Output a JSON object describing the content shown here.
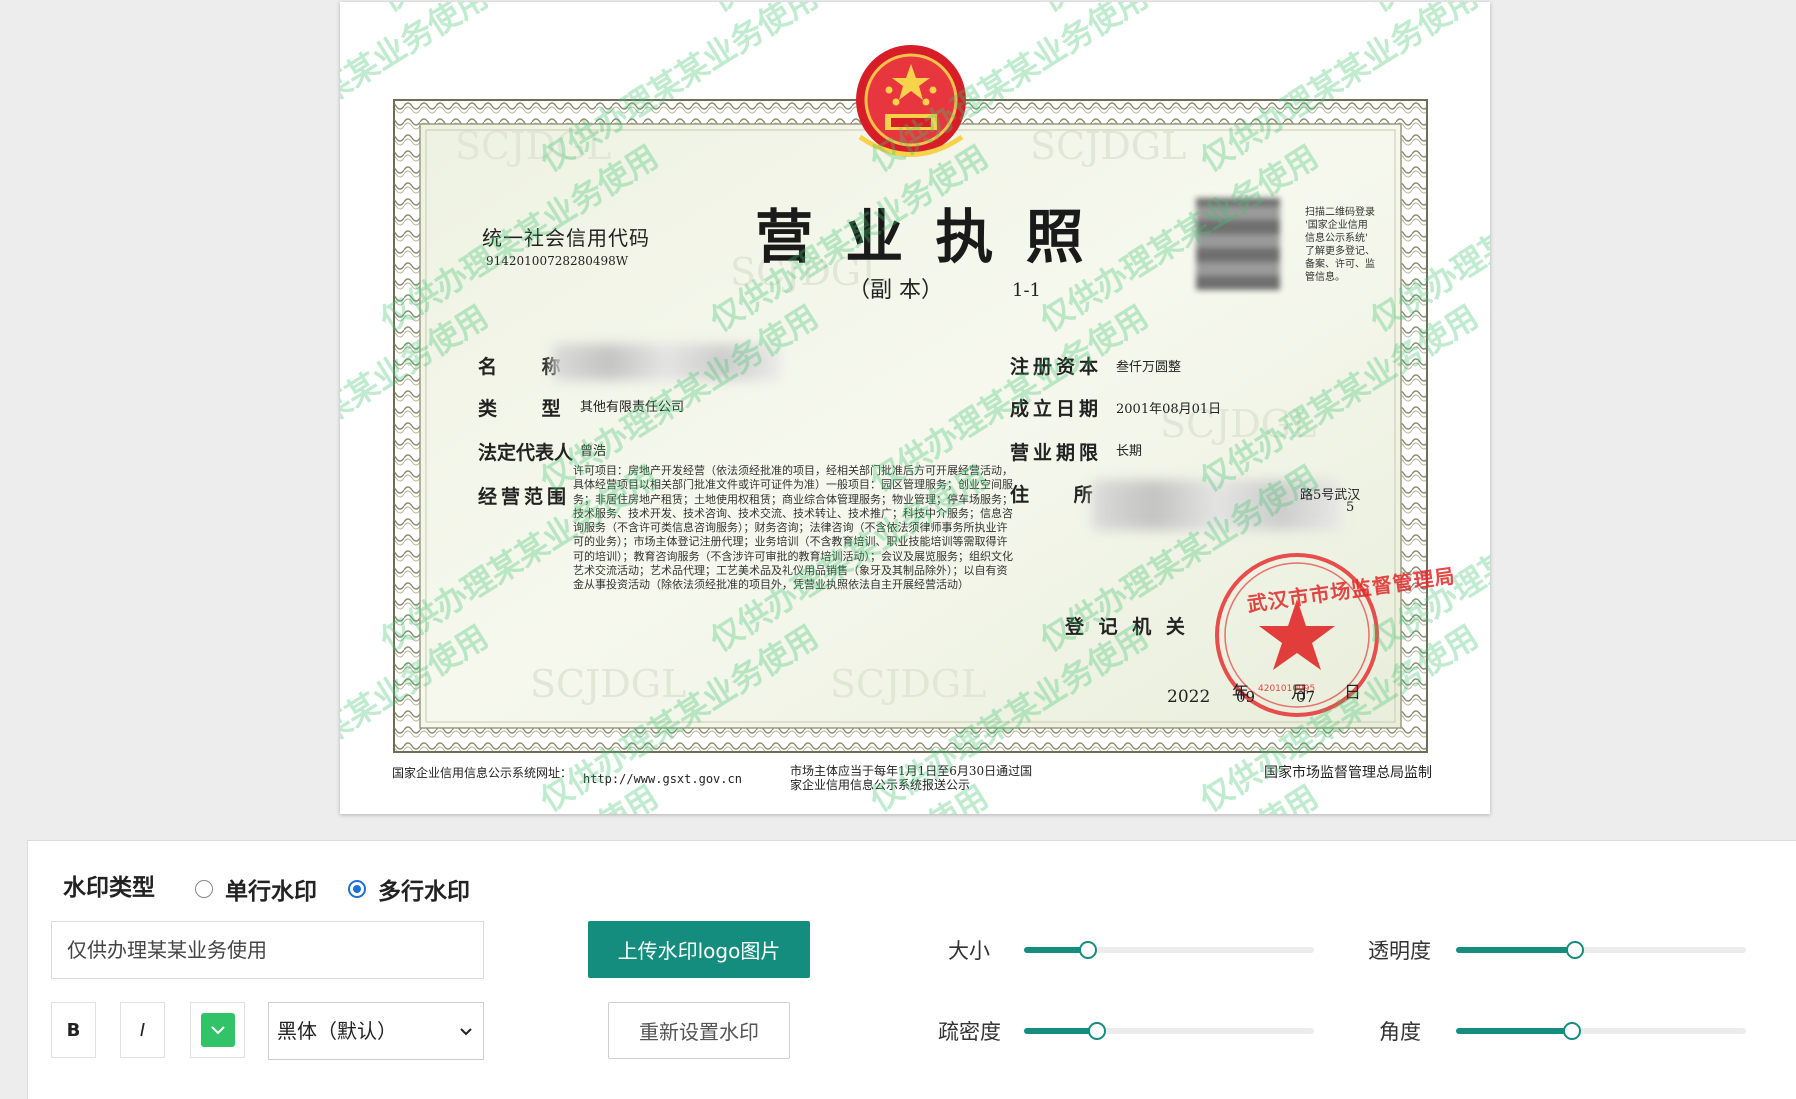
{
  "certificate": {
    "title": "营 业 执 照",
    "subtitle": "（副 本）",
    "copy_no": "1-1",
    "credit_code_label": "统一社会信用代码",
    "credit_code": "91420100728280498W",
    "qr_note": [
      "扫描二维码登录",
      "'国家企业信用",
      "信息公示系统'",
      "了解更多登记、",
      "备案、许可、监",
      "管信息。"
    ],
    "fields": {
      "name_label": "名 称",
      "type_label": "类 型",
      "type_value": "其他有限责任公司",
      "legal_rep_label": "法定代表人",
      "legal_rep_value": "曾浩",
      "scope_label": "经营范围",
      "capital_label": "注册资本",
      "capital_value": "叁仟万圆整",
      "founded_label": "成立日期",
      "founded_value": "2001年08月01日",
      "term_label": "营业期限",
      "term_value": "长期",
      "address_label": "住 所",
      "address_partial": "路5号武汉",
      "address_partial_2": "5"
    },
    "scope_text": "许可项目：房地产开发经营（依法须经批准的项目，经相关部门批准后方可开展经营活动，具体经营项目以相关部门批准文件或许可证件为准）一般项目：园区管理服务；创业空间服务；非居住房地产租赁；土地使用权租赁；商业综合体管理服务；物业管理；停车场服务；技术服务、技术开发、技术咨询、技术交流、技术转让、技术推广；科技中介服务；信息咨询服务（不含许可类信息咨询服务）；财务咨询；法律咨询（不含依法须律师事务所执业许可的业务）；市场主体登记注册代理；业务培训（不含教育培训、职业技能培训等需取得许可的培训）；教育咨询服务（不含涉许可审批的教育培训活动）；会议及展览服务；组织文化艺术交流活动；艺术品代理；工艺美术品及礼仪用品销售（象牙及其制品除外）；以自有资金从事投资活动（除依法须经批准的项目外，凭营业执照依法自主开展经营活动）",
    "registration_label": "登 记 机 关",
    "date_year": "2022",
    "date_year_unit": "年",
    "date_month": "09",
    "date_month_unit": "月",
    "date_day": "07",
    "date_day_unit": "日",
    "seal_text": "武汉市市场监督管理局",
    "seal_code": "4201010095",
    "background_mark": "SCJDGL",
    "footer_left_label": "国家企业信用信息公示系统网址：",
    "footer_left_url": "http://www.gsxt.gov.cn",
    "footer_middle": [
      "市场主体应当于每年1月1日至6月30日通过国",
      "家企业信用信息公示系统报送公示"
    ],
    "footer_right": "国家市场监督管理总局监制",
    "watermark_text": "仅供办理某某业务使用"
  },
  "panel": {
    "type_label": "水印类型",
    "option_single": "单行水印",
    "option_multi": "多行水印",
    "selected": "multi",
    "text_input_value": "仅供办理某某业务使用",
    "bold_label": "B",
    "italic_label": "I",
    "color_value": "#32c369",
    "font_select": "黑体（默认）",
    "upload_label": "上传水印logo图片",
    "reset_label": "重新设置水印",
    "sliders": [
      {
        "label": "大小",
        "value": 0.22
      },
      {
        "label": "透明度",
        "value": 0.41
      },
      {
        "label": "疏密度",
        "value": 0.25
      },
      {
        "label": "角度",
        "value": 0.4
      }
    ],
    "accent": "#158d7e",
    "radio_color": "#1e6fd9"
  }
}
